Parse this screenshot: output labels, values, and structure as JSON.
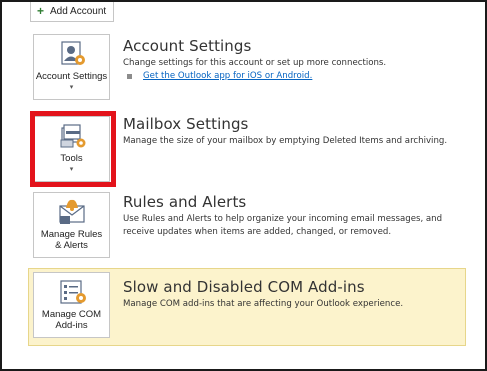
{
  "add_account": {
    "label": "Add Account",
    "icon": "plus-icon",
    "icon_color": "#2f7d32"
  },
  "sections": [
    {
      "id": "account-settings",
      "tile_label": "Account Settings",
      "has_caret": true,
      "icon": "account-settings-icon",
      "title": "Account Settings",
      "description": "Change settings for this account or set up more connections.",
      "link": "Get the Outlook app for iOS or Android."
    },
    {
      "id": "mailbox-settings",
      "tile_label": "Tools",
      "has_caret": true,
      "icon": "tools-icon",
      "title": "Mailbox Settings",
      "description": "Manage the size of your mailbox by emptying Deleted Items and archiving.",
      "highlighted": true,
      "highlight_color": "#e3131b"
    },
    {
      "id": "rules-and-alerts",
      "tile_label": "Manage Rules & Alerts",
      "has_caret": false,
      "icon": "rules-alerts-icon",
      "title": "Rules and Alerts",
      "description": "Use Rules and Alerts to help organize your incoming email messages, and receive updates when items are added, changed, or removed."
    },
    {
      "id": "com-addins",
      "tile_label": "Manage COM Add-ins",
      "has_caret": false,
      "icon": "com-addins-icon",
      "title": "Slow and Disabled COM Add-ins",
      "description": "Manage COM add-ins that are affecting your Outlook experience.",
      "background": "#fcf3cc"
    }
  ]
}
